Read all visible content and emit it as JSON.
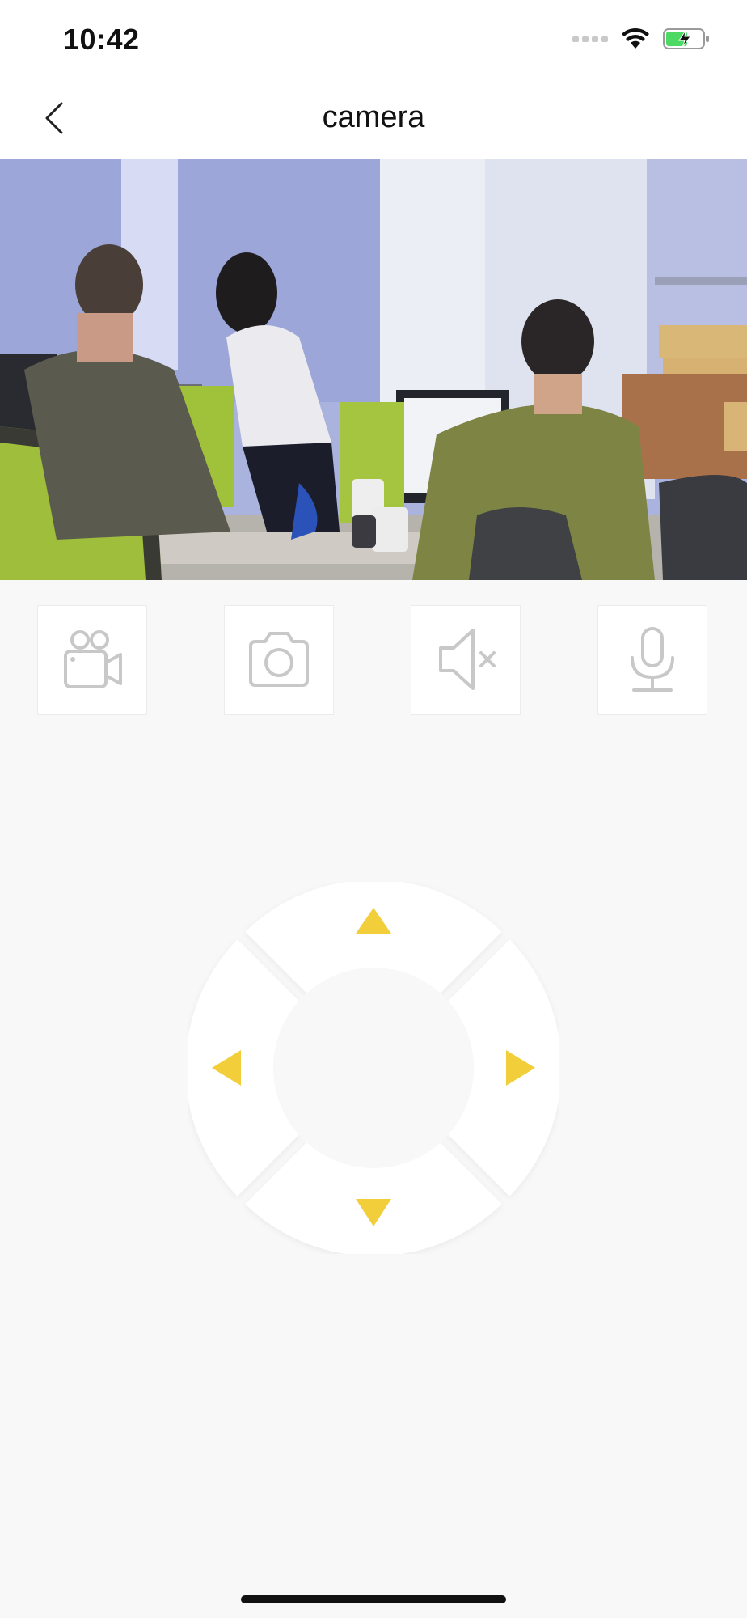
{
  "status_bar": {
    "time": "10:42",
    "icons": [
      "signal-dots-icon",
      "wifi-icon",
      "battery-charging-icon"
    ]
  },
  "nav": {
    "title": "camera",
    "back_icon": "chevron-left-icon"
  },
  "video": {
    "description_icon": "live-camera-feed"
  },
  "controls": [
    {
      "name": "record-video",
      "icon": "video-camera-icon"
    },
    {
      "name": "snapshot",
      "icon": "camera-icon"
    },
    {
      "name": "mute",
      "icon": "speaker-muted-icon"
    },
    {
      "name": "microphone",
      "icon": "microphone-icon"
    }
  ],
  "ptz": {
    "directions": [
      "up",
      "left",
      "right",
      "down"
    ],
    "arrow_color": "#f2cf3a"
  },
  "colors": {
    "icon_gray": "#c8c8c8",
    "background": "#f8f8f8",
    "accent_yellow": "#f2cf3a"
  }
}
